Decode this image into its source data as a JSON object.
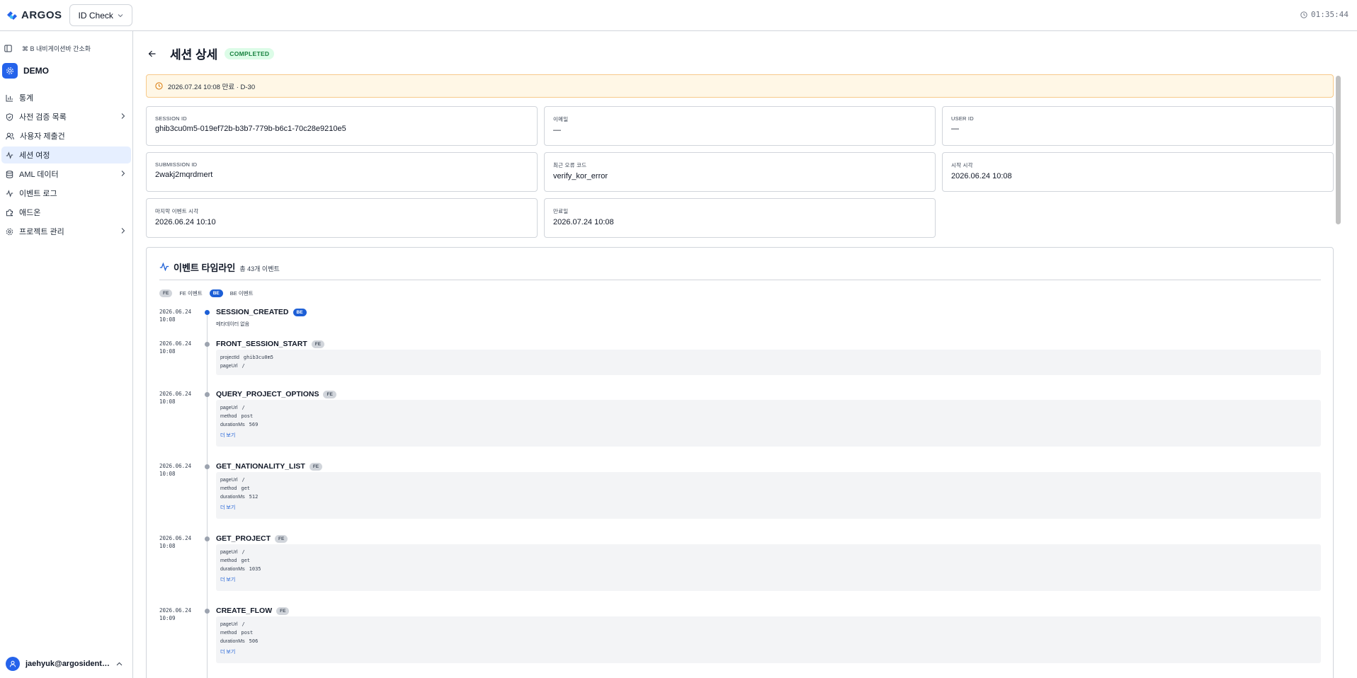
{
  "topbar": {
    "brand": "ARGOS",
    "product": "ID Check",
    "clock": "01:35:44"
  },
  "sidebar": {
    "shortcut_hint": "⌘ B 내비게이션바 간소화",
    "project": "DEMO",
    "items": [
      {
        "label": "통계",
        "icon": "bar-chart-icon",
        "has_submenu": false
      },
      {
        "label": "사전 검증 목록",
        "icon": "shield-check-icon",
        "has_submenu": true
      },
      {
        "label": "사용자 제출건",
        "icon": "users-icon",
        "has_submenu": false
      },
      {
        "label": "세션 여정",
        "icon": "activity-icon",
        "has_submenu": false,
        "active": true
      },
      {
        "label": "AML 데이터",
        "icon": "database-icon",
        "has_submenu": true
      },
      {
        "label": "이벤트 로그",
        "icon": "activity-icon",
        "has_submenu": false
      },
      {
        "label": "애드온",
        "icon": "puzzle-icon",
        "has_submenu": false
      },
      {
        "label": "프로젝트 관리",
        "icon": "gear-icon",
        "has_submenu": true
      }
    ],
    "user_email": "jaehyuk@argosidentity.com"
  },
  "page": {
    "title": "세션 상세",
    "status": "COMPLETED",
    "expiry_notice": "2026.07.24 10:08 만료 · D-30"
  },
  "fields": [
    {
      "label": "SESSION ID",
      "value": "ghib3cu0m5-019ef72b-b3b7-779b-b6c1-70c28e9210e5"
    },
    {
      "label": "이메일",
      "value": "—"
    },
    {
      "label": "USER ID",
      "value": "—"
    },
    {
      "label": "SUBMISSION ID",
      "value": "2wakj2mqrdmert"
    },
    {
      "label": "최근 오류 코드",
      "value": "verify_kor_error"
    },
    {
      "label": "시작 시각",
      "value": "2026.06.24 10:08"
    },
    {
      "label": "마지막 이벤트 시각",
      "value": "2026.06.24 10:10"
    },
    {
      "label": "만료일",
      "value": "2026.07.24 10:08"
    }
  ],
  "timeline": {
    "title": "이벤트 타임라인",
    "count_label": "총 43개 이벤트",
    "legend": {
      "fe_tag": "FE",
      "fe_label": "FE 이벤트",
      "be_tag": "BE",
      "be_label": "BE 이벤트"
    },
    "more_label": "더 보기",
    "events": [
      {
        "date": "2026.06.24",
        "time": "10:08",
        "name": "SESSION_CREATED",
        "tag": "BE",
        "note": "메타데이터 없음",
        "meta": []
      },
      {
        "date": "2026.06.24",
        "time": "10:08",
        "name": "FRONT_SESSION_START",
        "tag": "FE",
        "meta": [
          {
            "k": "projectId",
            "v": "ghib3cu0m5"
          },
          {
            "k": "pageUrl",
            "v": "/"
          }
        ],
        "more": false
      },
      {
        "date": "2026.06.24",
        "time": "10:08",
        "name": "QUERY_PROJECT_OPTIONS",
        "tag": "FE",
        "meta": [
          {
            "k": "pageUrl",
            "v": "/"
          },
          {
            "k": "method",
            "v": "post"
          },
          {
            "k": "durationMs",
            "v": "569"
          }
        ],
        "more": true
      },
      {
        "date": "2026.06.24",
        "time": "10:08",
        "name": "GET_NATIONALITY_LIST",
        "tag": "FE",
        "meta": [
          {
            "k": "pageUrl",
            "v": "/"
          },
          {
            "k": "method",
            "v": "get"
          },
          {
            "k": "durationMs",
            "v": "512"
          }
        ],
        "more": true
      },
      {
        "date": "2026.06.24",
        "time": "10:08",
        "name": "GET_PROJECT",
        "tag": "FE",
        "meta": [
          {
            "k": "pageUrl",
            "v": "/"
          },
          {
            "k": "method",
            "v": "get"
          },
          {
            "k": "durationMs",
            "v": "1035"
          }
        ],
        "more": true
      },
      {
        "date": "2026.06.24",
        "time": "10:09",
        "name": "CREATE_FLOW",
        "tag": "FE",
        "meta": [
          {
            "k": "pageUrl",
            "v": "/"
          },
          {
            "k": "method",
            "v": "post"
          },
          {
            "k": "durationMs",
            "v": "506"
          }
        ],
        "more": true
      }
    ]
  },
  "colors": {
    "accent": "#2563eb",
    "active_nav": "#e6efff",
    "success": "#15803d",
    "warning_bg": "#fff7e6"
  }
}
